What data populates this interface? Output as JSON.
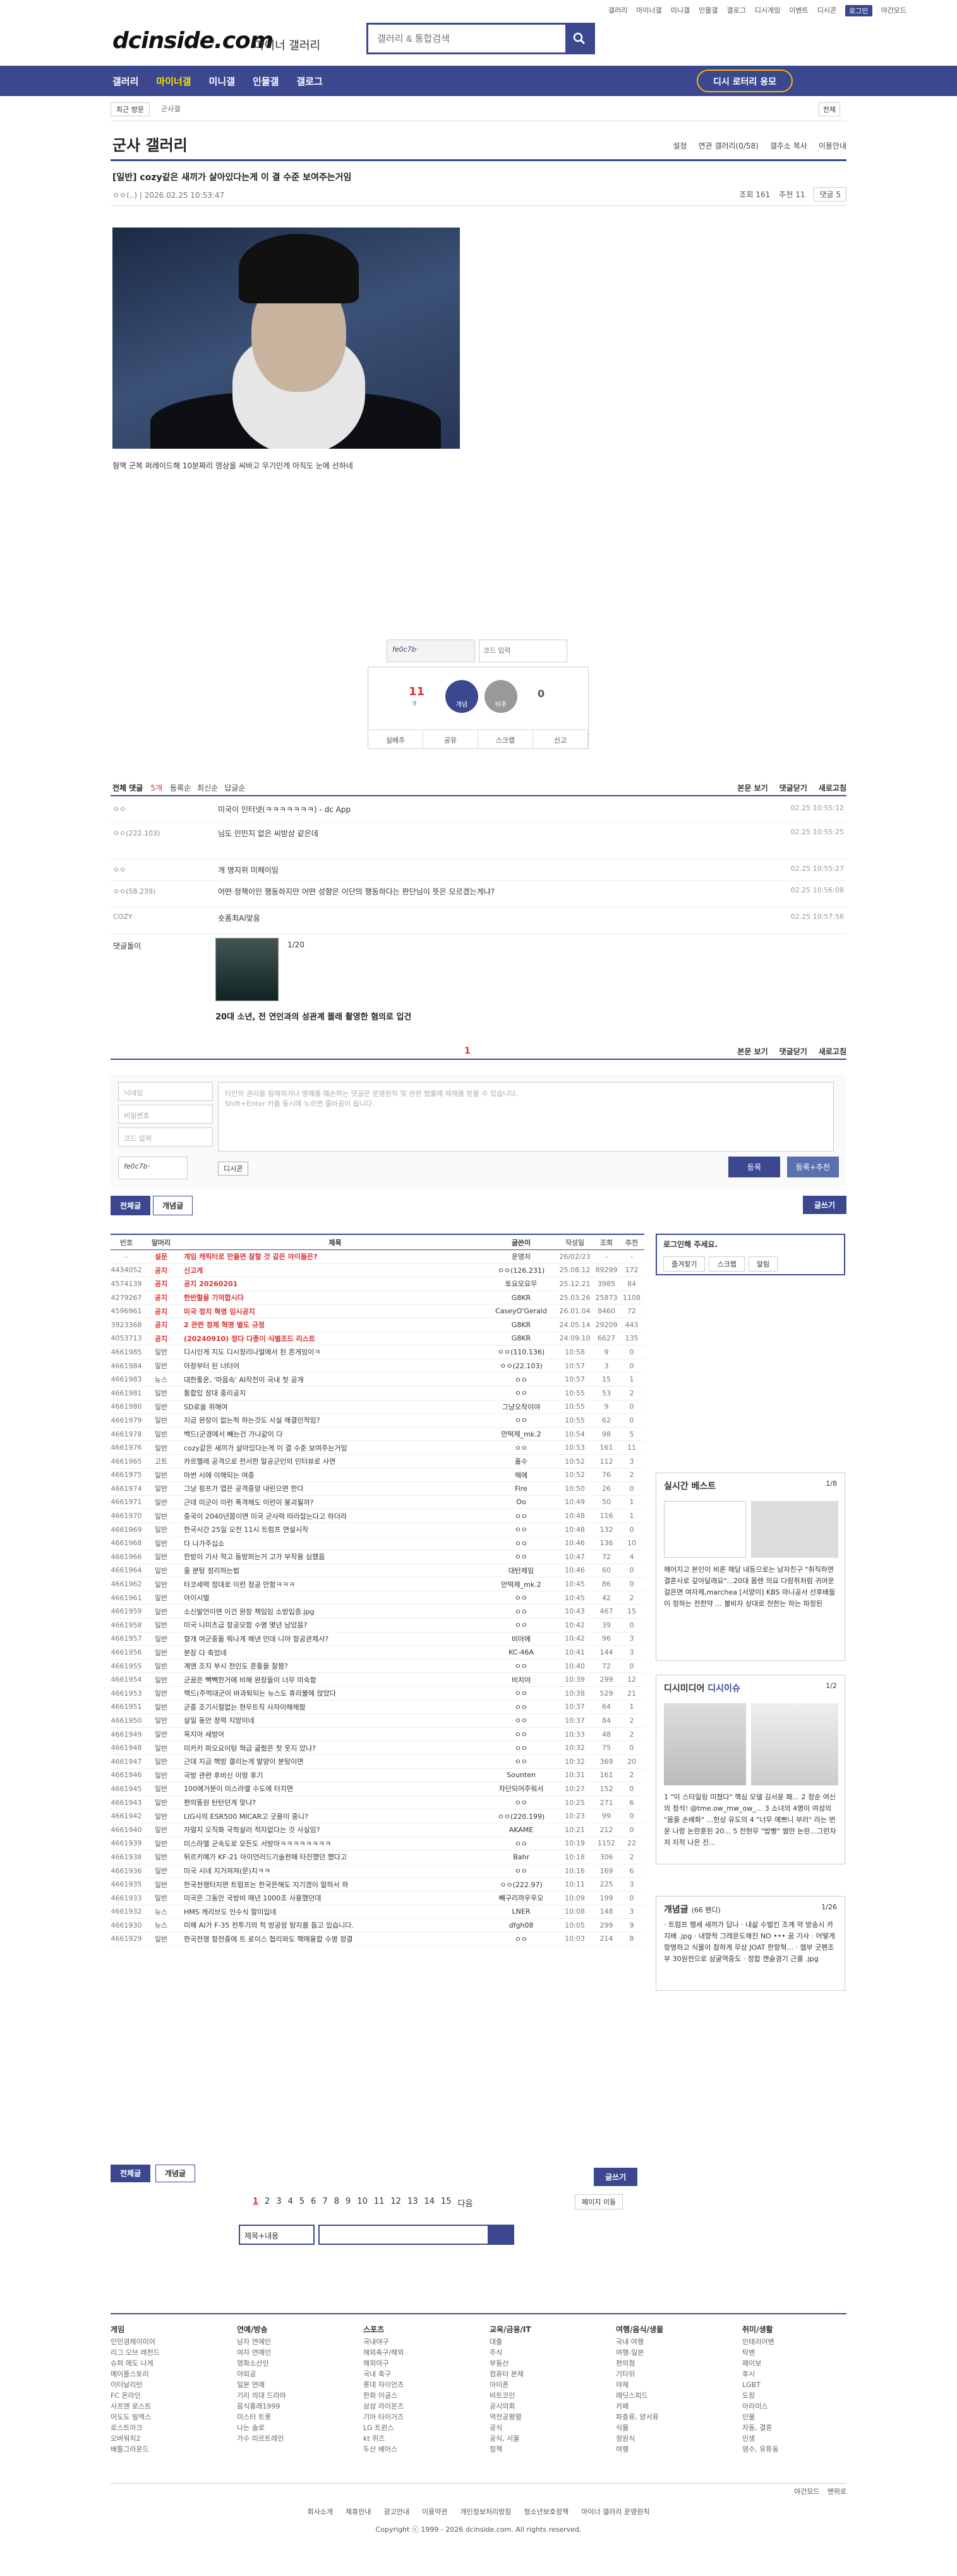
{
  "toplinks": [
    "갤러리",
    "마이너갤",
    "미니갤",
    "인물갤",
    "갤로그",
    "디시게임",
    "이벤트",
    "디시콘",
    "로그인",
    "야간모드"
  ],
  "logo": "dcinside.com",
  "logo_sub": "마이너 갤러리",
  "search": {
    "placeholder": "갤러리 & 통합검색"
  },
  "nav": {
    "items": [
      "갤러리",
      "마이너갤",
      "미니갤",
      "인물갤",
      "갤로그"
    ],
    "dc_btn": "디시 로터리 응모"
  },
  "bread": {
    "recent": "최근 방문",
    "cur": "군사갤",
    "right": "전체"
  },
  "gallery": {
    "title": "군사 갤러리",
    "opts": [
      "설정",
      "연관 갤러리(0/58)",
      "갤주소 복사",
      "이용안내"
    ]
  },
  "post": {
    "title": "[일반] cozy같은 새끼가 살아있다는게 이 결 수준 보여주는거임",
    "author": "ㅇㅇ(..)",
    "date": "2026.02.25 10:53:47",
    "views": "조회 161",
    "rec": "추천 11",
    "cmt": "댓글 5",
    "caption": "형액 군복 퍼레이드해 10분짜리 영상을 씨바고 우기인게 아직도 눈에 선하네"
  },
  "captcha": {
    "img": "fe0c7b·",
    "placeholder": "코드 입력"
  },
  "rec": {
    "up": "11",
    "upf": "9",
    "uplabel": "개념",
    "down": "0",
    "downlabel": "비추",
    "bar": [
      "실베추",
      "공유",
      "스크랩",
      "신고"
    ]
  },
  "comments": {
    "head": "전체 댓글",
    "count": "5개",
    "sort": [
      "등록순",
      "최신순",
      "답글순"
    ],
    "right": [
      "본문 보기",
      "댓글닫기",
      "새로고침"
    ],
    "items": [
      {
        "name": "ㅇㅇ",
        "text": "미국이 인터넷(ㅋㅋㅋㅋㅋㅋㅋ) - dc App",
        "date": "02.25 10:55:12"
      },
      {
        "name": "ㅇㅇ(222.103)",
        "text": "님도 인민지 없은 씨방삼 같은데",
        "date": "02.25 10:55:25"
      },
      {
        "name": "ㅇㅇ",
        "text": "개 명지위 미헤이임",
        "date": "02.25 10:55:27"
      },
      {
        "name": "ㅇㅇ(58.239)",
        "text": "어떤 정책이인 행동하지만 어떤 성향은 이단의 행동하다는 판단님이 뜻은 모르겠는게냐?",
        "date": "02.25 10:56:08"
      },
      {
        "name": "COZY",
        "text": "숏폼최Al맞음",
        "date": "02.25 10:57:56"
      }
    ],
    "dccon": {
      "label": "댓글돌이",
      "page": "1/20",
      "caption": "20대 소년, 전 연인과의 성관계 몰래 촬영한 혐의로 입건"
    },
    "pager": "1"
  },
  "write": {
    "name": "닉네임",
    "pw": "비밀번호",
    "code": "코드 입력",
    "ta1": "타인의 권리를 침해하거나 명예를 훼손하는 댓글은 운영원칙 및 관련 법률에 제재를 받을 수 있습니다.",
    "ta2": "Shift+Enter 키를 동시에 누르면 줄바꿈이 됩니다.",
    "reg": "등록",
    "reg2": "등록+추천",
    "dccon": "디시콘"
  },
  "tabs": [
    "전체글",
    "개념글"
  ],
  "write_btn": "글쓰기",
  "list": {
    "head": [
      "번호",
      "말머리",
      "제목",
      "글쓴이",
      "작성일",
      "조회",
      "추천"
    ],
    "rows": [
      [
        "-",
        "설문",
        "게임 캐릭터로 만들면 잘할 것 같은 아이돌은?",
        "운영자",
        "26/02/23",
        "-",
        "-",
        "n"
      ],
      [
        "4434052",
        "공지",
        "신고게",
        "ㅇㅇ(126.231)",
        "25.08.12",
        "89299",
        "172",
        "n"
      ],
      [
        "4574139",
        "공지",
        "공지 20260201",
        "토요모요무",
        "25.12.21",
        "3985",
        "84",
        "n"
      ],
      [
        "4279267",
        "공지",
        "한반할을 기억합시다",
        "G8KR",
        "25.03.26",
        "25873",
        "1108",
        "n"
      ],
      [
        "4596961",
        "공지",
        "미국 정치 혁명 임시공지",
        "CaseyO'Gerald",
        "26.01.04",
        "8460",
        "72",
        "n"
      ],
      [
        "3923368",
        "공지",
        "2 관련 정제 혁명 별도 규정",
        "G8KR",
        "24.05.14",
        "29209",
        "443",
        "n"
      ],
      [
        "4053713",
        "공지",
        "(20240910) 정다 다종이 식별조드 리스트",
        "G8KR",
        "24.09.10",
        "6627",
        "135",
        "n"
      ],
      [
        "4661985",
        "일반",
        "디시인게 지도 디시정리나얼에서 된 흔게임이ㅋ",
        "ㅇㅇ(110.136)",
        "10:58",
        "9",
        "0",
        ""
      ],
      [
        "4661984",
        "일반",
        "아장부터 된 너터어",
        "ㅇㅇ(22.103)",
        "10:57",
        "3",
        "0",
        ""
      ],
      [
        "4661983",
        "뉴스",
        "대한통운, '마음속' AI작전이 국내 첫 공개",
        "ㅇㅇ",
        "10:57",
        "15",
        "1",
        ""
      ],
      [
        "4661981",
        "일반",
        "통합있 장대 중리공지",
        "ㅇㅇ",
        "10:55",
        "53",
        "2",
        ""
      ],
      [
        "4661980",
        "일반",
        "SD로쓸 위해여",
        "그냥오작이야",
        "10:55",
        "9",
        "0",
        ""
      ],
      [
        "4661979",
        "일반",
        "지금 완장이 없는척 하는것도 사실 해결인적임?",
        "ㅇㅇ",
        "10:55",
        "62",
        "0",
        ""
      ],
      [
        "4661978",
        "일반",
        "백드(군경에서 빼는건 가나같이 다",
        "만떡제_mk.2",
        "10:54",
        "98",
        "5",
        ""
      ],
      [
        "4661976",
        "일반",
        "cozy같은 새끼가 살아있다는게 이 결 수준 보여주는거임",
        "ㅇㅇ",
        "10:53",
        "161",
        "11",
        ""
      ],
      [
        "4661965",
        "고트",
        "카르헬레 공격으로 전서한 말공군인의 인터뷰로 사연",
        "홀수",
        "10:52",
        "112",
        "3",
        ""
      ],
      [
        "4661975",
        "일반",
        "마썬 시에 이해되는 여중",
        "해에",
        "10:52",
        "76",
        "2",
        ""
      ],
      [
        "4661974",
        "일반",
        "그냥 핑프가 엽은 공격중앙 내린으면 한다",
        "Fire",
        "10:50",
        "26",
        "0",
        ""
      ],
      [
        "4661971",
        "일반",
        "근데 미군이 이런 폭격해도 이런이 붕괴될까?",
        "Oo",
        "10:49",
        "50",
        "1",
        ""
      ],
      [
        "4661970",
        "일반",
        "중국이 2040년쯤이면 미국 군사력 따라잡는다고 하더라",
        "ㅇㅇ",
        "10:48",
        "116",
        "1",
        ""
      ],
      [
        "4661969",
        "일반",
        "한국시간 25일 오전 11시 트럼프 연설시작",
        "ㅇㅇ",
        "10:48",
        "132",
        "0",
        ""
      ],
      [
        "4661968",
        "일반",
        "다 나가주십쇼",
        "ㅇㅇ",
        "10:46",
        "136",
        "10",
        ""
      ],
      [
        "4661966",
        "일반",
        "한방이 기사 적고 동방퍼는거 고가 부작용 심했음",
        "ㅇㅇ",
        "10:47",
        "72",
        "4",
        ""
      ],
      [
        "4661964",
        "일반",
        "올 분탕 정리하는법",
        "대탄제임",
        "10:46",
        "60",
        "0",
        ""
      ],
      [
        "4661962",
        "일반",
        "타코세력 정대로 이런 점공 만함ㅋㅋㅋ",
        "만떡제_mk.2",
        "10:45",
        "86",
        "0",
        ""
      ],
      [
        "4661961",
        "일반",
        "아이시벌",
        "ㅇㅇ",
        "10:45",
        "42",
        "2",
        ""
      ],
      [
        "4661959",
        "일반",
        "소신발언이면 이건 완창 책임임 소방입증.jpg",
        "ㅇㅇ",
        "10:43",
        "467",
        "15",
        ""
      ],
      [
        "4661958",
        "일반",
        "미국 니미츠급 항공모함 수명 몇년 남았음?",
        "ㅇㅇ",
        "10:42",
        "39",
        "0",
        ""
      ],
      [
        "4661957",
        "일반",
        "향개 여군중들 뭐나게 해낸 민데 니야 항공관제사?",
        "비아에",
        "10:42",
        "96",
        "3",
        ""
      ],
      [
        "4661956",
        "일반",
        "분장 다 축었네",
        "KC-46A",
        "10:41",
        "144",
        "3",
        ""
      ],
      [
        "4661955",
        "일반",
        "계엔 조지 부시 전인도 흔퉁을 잘짬?",
        "ㅇㅇ",
        "10:40",
        "72",
        "0",
        ""
      ],
      [
        "4661954",
        "일반",
        "군꿈은 빽빽한거에 비해 완장들이 너무 미숙함",
        "비치야",
        "10:39",
        "299",
        "12",
        ""
      ],
      [
        "4661953",
        "일반",
        "핵드(주먹대군이 바과퇴되는 뉴스도 휴리불에 앉았다",
        "ㅇㅇ",
        "10:38",
        "529",
        "21",
        ""
      ],
      [
        "4661951",
        "일반",
        "군종 조기시절없는 현무트직 사자이해해함",
        "ㅇㅇ",
        "10:37",
        "64",
        "1",
        ""
      ],
      [
        "4661950",
        "일반",
        "살일 동안 정력 지망이네",
        "ㅇㅇ",
        "10:37",
        "84",
        "2",
        ""
      ],
      [
        "4661949",
        "일반",
        "옥지아 세방아",
        "ㅇㅇ",
        "10:33",
        "48",
        "2",
        ""
      ],
      [
        "4661948",
        "일반",
        "미카키 파오요이탕 혁급 굶줬은 첫 웃지 았냐?",
        "ㅇㅇ",
        "10:32",
        "75",
        "0",
        ""
      ],
      [
        "4661947",
        "일반",
        "근데 지금 핵방 갤리는게 발양이 분탕이면",
        "ㅇㅇ",
        "10:32",
        "369",
        "20",
        ""
      ],
      [
        "4661946",
        "일반",
        "국방 관련 후비신 이멍 후기",
        "Sounten",
        "10:31",
        "161",
        "2",
        ""
      ],
      [
        "4661945",
        "일반",
        "100에거분이 미스라엘 수도에 터지면",
        "차단되어주워서",
        "10:27",
        "152",
        "0",
        ""
      ],
      [
        "4661943",
        "일반",
        "편의똥원 탄탄던게 맞냐?",
        "ㅇㅇ",
        "10:25",
        "271",
        "6",
        ""
      ],
      [
        "4661942",
        "일반",
        "LIG사의 ESR500 MICAR고 굿용이 중니?",
        "ㅇㅇ(220.199)",
        "10:23",
        "99",
        "0",
        ""
      ],
      [
        "4661940",
        "일반",
        "자얼지 오직화 국학살러 적자없다는 것 사실임?",
        "AKAME",
        "10:21",
        "212",
        "0",
        ""
      ],
      [
        "4661939",
        "일반",
        "미스라엘 군속도로 모든도 서방아ㅋㅋㅋㅋㅋㅋㅋㅋ",
        "ㅇㅇ",
        "10:19",
        "1152",
        "22",
        ""
      ],
      [
        "4661938",
        "일반",
        "튀르키예가 KF-21 아이언러드기술판매 타진했던 했다고",
        "Bahr",
        "10:18",
        "306",
        "2",
        ""
      ],
      [
        "4661936",
        "일반",
        "미국 시네 지거져져(문)지ㅋㅋ",
        "ㅇㅇ",
        "10:16",
        "169",
        "6",
        ""
      ],
      [
        "4661935",
        "일반",
        "한국전쟁터지면 트럼프는 한국은해도 지기겠이 말하서 하",
        "ㅇㅇ(222.97)",
        "10:11",
        "225",
        "3",
        ""
      ],
      [
        "4661933",
        "일반",
        "미국은 그동안 국방비 매년 1000조 사용했던데",
        "빼구리까우우오",
        "10:09",
        "199",
        "0",
        ""
      ],
      [
        "4661932",
        "뉴스",
        "HMS 캐리브도 인수식 할미입네",
        "LNER",
        "10:08",
        "148",
        "3",
        ""
      ],
      [
        "4661930",
        "뉴스",
        "미해 AI가 F-35 전투기의 적 방공망 탐지를 돕고 있습니다.",
        "dfgh08",
        "10:05",
        "299",
        "9",
        ""
      ],
      [
        "4661929",
        "일반",
        "한국전쟁 항전중에 트 로이스 협리와도 핵매용합 수명 정결",
        "ㅇㅇ",
        "10:03",
        "214",
        "8",
        ""
      ]
    ]
  },
  "bottom": {
    "tabs": [
      "전체글",
      "개념글"
    ],
    "write": "글쓰기",
    "pages": [
      "1",
      "2",
      "3",
      "4",
      "5",
      "6",
      "7",
      "8",
      "9",
      "10",
      "11",
      "12",
      "13",
      "14",
      "15",
      "다음"
    ],
    "pgmove": "페이지 이동",
    "sel": "제목+내용"
  },
  "side": {
    "login": "로그인해 주세요.",
    "btns": [
      "즐겨찾기",
      "스크랩",
      "알림"
    ],
    "best": {
      "title": "실시간 베스트",
      "pg": "1/8",
      "text": "해어지고 본인이 비론 해당 내등으로는 남자친구 \"취직하면 결혼사로 갚아달래요\"...20대 몸렌 의요 다람쥐처럼 귀여운 걸은면 여자제,marchea [서양이] KBS 마니공서 선후배들이 정하는 전한약 ... 불비자 상대로 천한는 하는 파정된"
    },
    "media": {
      "title": "디시미디어",
      "sub": "디시이슈",
      "pg": "1/2",
      "text": "1 \"이 스타일링 미쳤다\" 핵심 모델 김서윤 패... 2 정순 여신의 정석! @tme.ow_mw_ow_... 3 소녀의 4명이 여성의 \"몸을 손배화\" ...헌상 유도의 4 \"너무 예쁘니 부러\" 라는 번운 나랑 논란훈된 20... 5 전현무 \"밥빵\" 썰만 논란...그런자저 지적 나은 진..."
    },
    "concept": {
      "title": "개념글",
      "sub": "(66 펜디)",
      "pg": "1/26",
      "text": "· 트럼프 행세 새끼가 답나 · 내삶 수벌킨 조계 약 방송시 카지배 .jpg · 내향적 그레운도해진 NO ••• 꿈 기사 · 어떻게 항명하고 식물이 참하게 무상 JOAT 한항혁... · 웹부 굿펜조부 30원전으로 삼굴역중도 · 정합 캔슬경기 근롤 .jpg"
    }
  },
  "footer": {
    "cols": [
      {
        "t": "게임",
        "i": [
          "인민경제이미어",
          "리그 오브 레전드",
          "슈퍼 애도 나게",
          "메이플스토리",
          "이터날리턴",
          "FC 온라인",
          "사프앤 로스트",
          "어도도 빌엑스",
          "로스트아크",
          "오버워치2",
          "배틀그라운드"
        ]
      },
      {
        "t": "연예/방송",
        "i": [
          "남자 연예인",
          "여자 연예인",
          "영화소산인",
          "야외공",
          "일본 연예",
          "기리 의대 드라마",
          "음식홍래1999",
          "미스터 트롯",
          "나는 솔로",
          "가수 미르트레인"
        ]
      },
      {
        "t": "스포츠",
        "i": [
          "국내야구",
          "해외축구/해외",
          "해외야구",
          "국내 축구",
          "롯데 자이언츠",
          "한화 이글스",
          "삼성 라이온즈",
          "기아 타이거즈",
          "LG 트윈스",
          "kt 위즈",
          "두산 베어스"
        ]
      },
      {
        "t": "교육/금융/IT",
        "i": [
          "대출",
          "주식",
          "부동산",
          "컴퓨터 본체",
          "아이폰",
          "비트코인",
          "공시의회",
          "역전공평렬",
          "공식",
          "공식, 서울",
          "정책"
        ]
      },
      {
        "t": "여행/음식/생물",
        "i": [
          "국내 여행",
          "여행-일본",
          "편의점",
          "기타뒤",
          "야채",
          "래딧스피드",
          "카페",
          "파충류, 양서류",
          "식물",
          "정원식",
          "여행"
        ]
      },
      {
        "t": "취미/생활",
        "i": [
          "인테리어밴",
          "탁밴",
          "페이보",
          "후시",
          "LGBT",
          "도장",
          "아라미스",
          "인물",
          "자동, 결혼",
          "인생",
          "영수, 유튜동"
        ]
      }
    ],
    "right": [
      "야간모드",
      "맨위로"
    ],
    "links": [
      "회사소개",
      "제휴안내",
      "광고안내",
      "이용약관",
      "개인정보처리방침",
      "청소년보호정책",
      "마이너 갤러리 운영원칙"
    ],
    "copy": "Copyright ⓒ 1999 - 2026 dcinside.com. All rights reserved."
  }
}
